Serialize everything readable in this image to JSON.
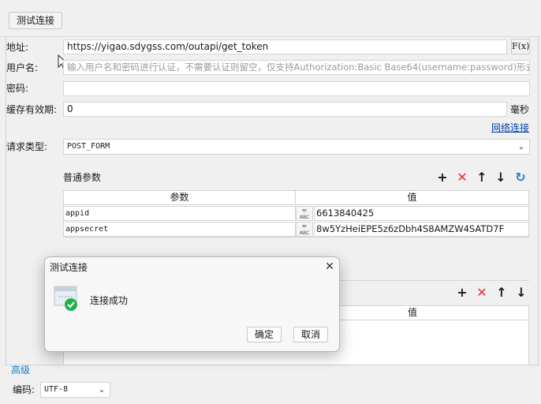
{
  "toolbar": {
    "test_button": "测试连接"
  },
  "form": {
    "address_label": "地址:",
    "address_value": "https://yigao.sdygss.com/outapi/get_token",
    "fx_label": "F(x)",
    "username_label": "用户名:",
    "username_placeholder": "输入用户名和密码进行认证，不需要认证则留空，仅支持Authorization:Basic Base64(username:password)形式",
    "password_label": "密码:",
    "cache_label": "缓存有效期:",
    "cache_value": "0",
    "cache_unit": "毫秒",
    "network_link": "网络连接",
    "request_type_label": "请求类型:",
    "request_type_value": "POST_FORM"
  },
  "params": {
    "title": "普通参数",
    "col_param": "参数",
    "col_value": "值",
    "rows": [
      {
        "name": "appid",
        "type_badge": "ABC",
        "value": "6613840425"
      },
      {
        "name": "appsecret",
        "type_badge": "ABC",
        "value": "8w5YzHeiEPE5z6zDbh4S8AMZW4SATD7F"
      }
    ]
  },
  "params2": {
    "col_value": "值"
  },
  "advanced": {
    "title": "高级",
    "encoding_label": "编码:",
    "encoding_value": "UTF-8"
  },
  "dialog": {
    "title": "测试连接",
    "message": "连接成功",
    "ok_button": "确定",
    "cancel_button": "取消"
  },
  "colors": {
    "accent": "#1a7fc7",
    "delete": "#e0302b",
    "success": "#22b14c",
    "link": "#0645ad"
  }
}
